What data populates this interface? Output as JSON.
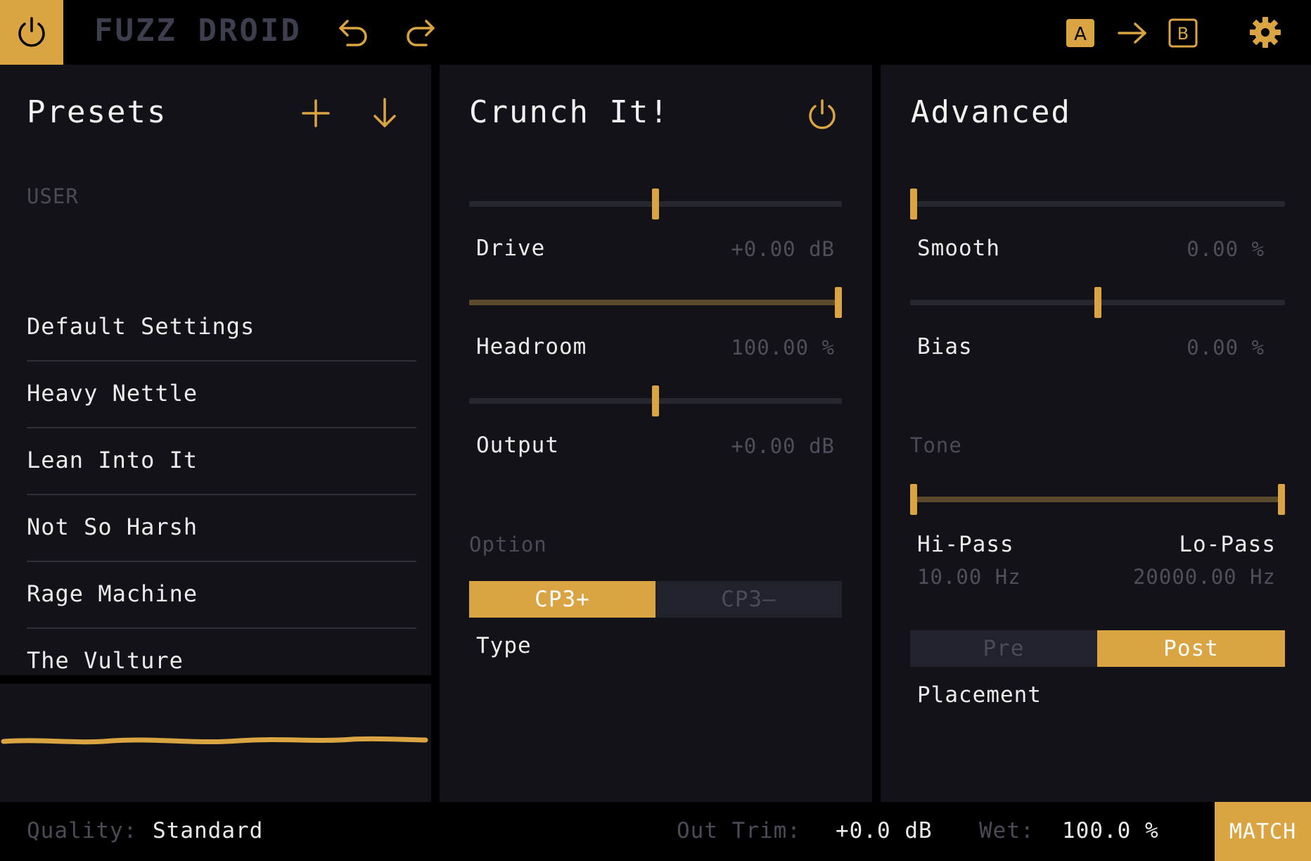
{
  "app": {
    "title": "FUZZ DROID",
    "accent_color": "#d9a441",
    "icons": [
      "power-icon",
      "undo-icon",
      "redo-icon",
      "ab-a-icon",
      "arrow-right-icon",
      "ab-b-icon",
      "gear-icon"
    ]
  },
  "presets": {
    "title": "Presets",
    "icons": [
      "plus-icon",
      "download-arrow-icon"
    ],
    "section_label": "USER",
    "items": [
      {
        "label": "Default Settings"
      },
      {
        "label": "Heavy Nettle"
      },
      {
        "label": "Lean Into It"
      },
      {
        "label": "Not So Harsh"
      },
      {
        "label": "Rage Machine"
      },
      {
        "label": "The Vulture"
      }
    ]
  },
  "crunch": {
    "title": "Crunch It!",
    "drive": {
      "label": "Drive",
      "value": "+0.00 dB",
      "position": 0.5
    },
    "headroom": {
      "label": "Headroom",
      "value": "100.00 %",
      "position": 1.0
    },
    "output": {
      "label": "Output",
      "value": "+0.00 dB",
      "position": 0.5
    },
    "option_label": "Option",
    "type": {
      "label": "Type",
      "options": [
        "CP3+",
        "CP3–"
      ],
      "selected": "CP3+"
    }
  },
  "advanced": {
    "title": "Advanced",
    "smooth": {
      "label": "Smooth",
      "value": "0.00 %",
      "position": 0.0
    },
    "bias": {
      "label": "Bias",
      "value": "0.00 %",
      "position": 0.5
    },
    "tone_label": "Tone",
    "hipass": {
      "label": "Hi-Pass",
      "value": "10.00 Hz",
      "position": 0.0
    },
    "lopass": {
      "label": "Lo-Pass",
      "value": "20000.00 Hz",
      "position": 1.0
    },
    "placement": {
      "label": "Placement",
      "options": [
        "Pre",
        "Post"
      ],
      "selected": "Post"
    }
  },
  "footer": {
    "quality_label": "Quality:",
    "quality_value": "Standard",
    "out_trim_label": "Out Trim:",
    "out_trim_value": "+0.0 dB",
    "wet_label": "Wet:",
    "wet_value": "100.0 %",
    "match_label": "MATCH"
  }
}
